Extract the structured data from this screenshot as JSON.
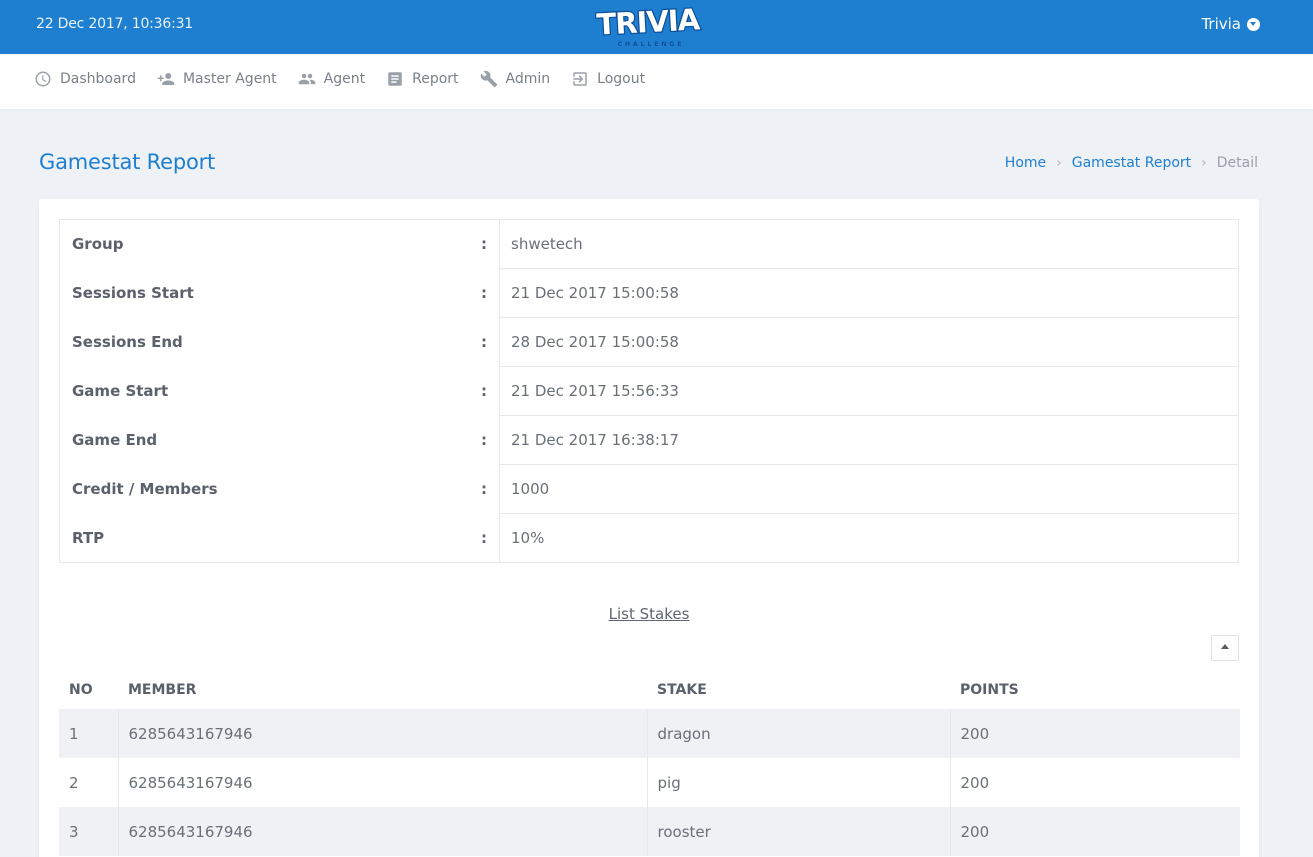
{
  "header": {
    "datetime": "22 Dec 2017, 10:36:31",
    "logo_text": "TRIVIA",
    "logo_subtext": "CHALLENGE",
    "user_label": "Trivia",
    "colors": {
      "primary": "#1e7fd1",
      "background": "#eef1f6"
    }
  },
  "nav": {
    "items": [
      {
        "label": "Dashboard",
        "icon": "dashboard-icon"
      },
      {
        "label": "Master Agent",
        "icon": "person-add-icon"
      },
      {
        "label": "Agent",
        "icon": "people-icon"
      },
      {
        "label": "Report",
        "icon": "report-icon"
      },
      {
        "label": "Admin",
        "icon": "wrench-icon"
      },
      {
        "label": "Logout",
        "icon": "logout-icon"
      }
    ]
  },
  "page": {
    "title": "Gamestat Report",
    "breadcrumb": [
      "Home",
      "Gamestat Report",
      "Detail"
    ]
  },
  "details": [
    {
      "label": "Group",
      "value": "shwetech"
    },
    {
      "label": "Sessions Start",
      "value": "21 Dec 2017 15:00:58"
    },
    {
      "label": "Sessions End",
      "value": "28 Dec 2017 15:00:58"
    },
    {
      "label": "Game Start",
      "value": "21 Dec 2017 15:56:33"
    },
    {
      "label": "Game End",
      "value": "21 Dec 2017 16:38:17"
    },
    {
      "label": "Credit / Members",
      "value": "1000"
    },
    {
      "label": "RTP",
      "value": "10%"
    }
  ],
  "separator": ":",
  "stakes": {
    "title": "List Stakes",
    "columns": [
      "NO",
      "MEMBER",
      "STAKE",
      "POINTS"
    ],
    "rows": [
      [
        "1",
        "6285643167946",
        "dragon",
        "200"
      ],
      [
        "2",
        "6285643167946",
        "pig",
        "200"
      ],
      [
        "3",
        "6285643167946",
        "rooster",
        "200"
      ]
    ]
  }
}
